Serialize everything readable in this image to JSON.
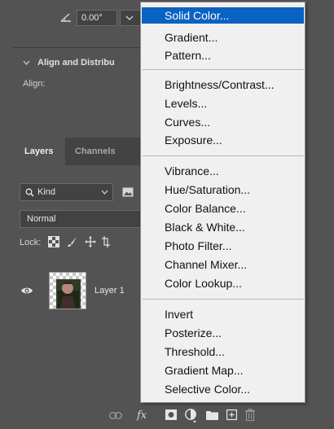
{
  "properties": {
    "angle_value": "0.00°",
    "align_section_title": "Align and Distribu",
    "align_label": "Align:"
  },
  "layers_panel": {
    "tabs": [
      "Layers",
      "Channels"
    ],
    "kind_filter": "Kind",
    "blend_mode": "Normal",
    "lock_label": "Lock:",
    "layers": [
      {
        "name": "Layer 1",
        "visible": true
      }
    ]
  },
  "adjustment_menu": {
    "groups": [
      [
        "Solid Color...",
        "Gradient...",
        "Pattern..."
      ],
      [
        "Brightness/Contrast...",
        "Levels...",
        "Curves...",
        "Exposure..."
      ],
      [
        "Vibrance...",
        "Hue/Saturation...",
        "Color Balance...",
        "Black & White...",
        "Photo Filter...",
        "Channel Mixer...",
        "Color Lookup..."
      ],
      [
        "Invert",
        "Posterize...",
        "Threshold...",
        "Gradient Map...",
        "Selective Color..."
      ]
    ],
    "highlighted_item": "Solid Color..."
  },
  "bottom_toolbar": {
    "fx_label": "fx",
    "icons": [
      "link-icon",
      "fx-icon",
      "add-mask-icon",
      "adjustment-layer-icon",
      "group-folder-icon",
      "new-layer-icon",
      "trash-icon"
    ]
  },
  "colors": {
    "panel_bg": "#535353",
    "menu_bg": "#f0f0f0",
    "menu_highlight": "#0a62c2"
  }
}
